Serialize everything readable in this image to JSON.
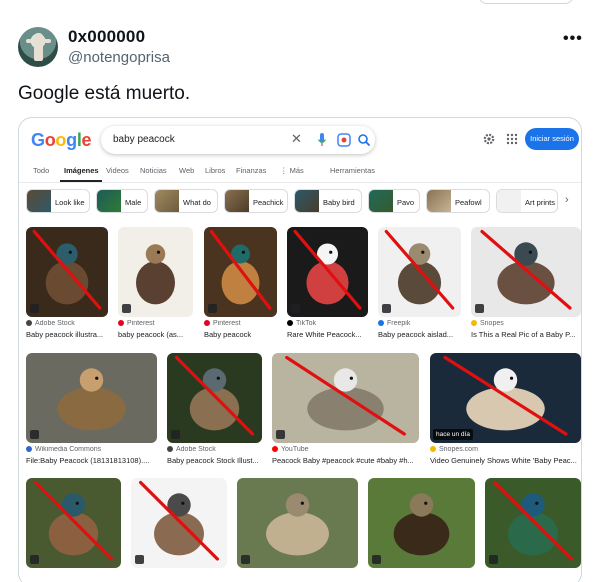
{
  "tweet": {
    "display_name": "0x000000",
    "handle": "@notengoprisa",
    "text": "Google está muerto.",
    "more_icon": "more-horizontal-icon"
  },
  "google": {
    "logo": "Google",
    "query": "baby peacock",
    "signin_label": "Iniciar sesión",
    "tabs": [
      "Todo",
      "Imágenes",
      "Videos",
      "Noticias",
      "Web",
      "Libros",
      "Finanzas",
      "⋮ Más",
      "Herramientas"
    ],
    "active_tab": "Imágenes",
    "chips": [
      "Look like",
      "Male",
      "What do",
      "Peachick",
      "Baby bird",
      "Pavo",
      "Peafowl",
      "Art prints"
    ],
    "results": [
      {
        "source": "Adobe Stock",
        "caption": "Baby peacock illustra...",
        "crossed": true
      },
      {
        "source": "Pinterest",
        "caption": "baby peacock (as...",
        "crossed": false
      },
      {
        "source": "Pinterest",
        "caption": "Baby peacock",
        "crossed": true
      },
      {
        "source": "TikTok",
        "caption": "Rare White Peacock...",
        "crossed": true
      },
      {
        "source": "Freepik",
        "caption": "Baby peacock aislad...",
        "crossed": true
      },
      {
        "source": "Snopes",
        "caption": "Is This a Real Pic of a Baby P...",
        "crossed": true
      },
      {
        "source": "Wikimedia Commons",
        "caption": "File:Baby Peacock (18131813108)....",
        "crossed": false
      },
      {
        "source": "Adobe Stock",
        "caption": "Baby peacock Stock Illust...",
        "crossed": true
      },
      {
        "source": "YouTube",
        "caption": "Peacock Baby #peacock #cute #baby #h...",
        "crossed": true
      },
      {
        "source": "Snopes.com",
        "caption": "Video Genuinely Shows White 'Baby Peac...",
        "crossed": true
      },
      {
        "source": "",
        "caption": "",
        "crossed": true
      },
      {
        "source": "",
        "caption": "",
        "crossed": true
      },
      {
        "source": "",
        "caption": "",
        "crossed": false
      },
      {
        "source": "",
        "caption": "",
        "crossed": false
      },
      {
        "source": "",
        "caption": "",
        "crossed": true
      }
    ],
    "overlay_text": "hace un día",
    "colors": {
      "accent": "#1a73e8",
      "cross": "#e01010"
    }
  }
}
